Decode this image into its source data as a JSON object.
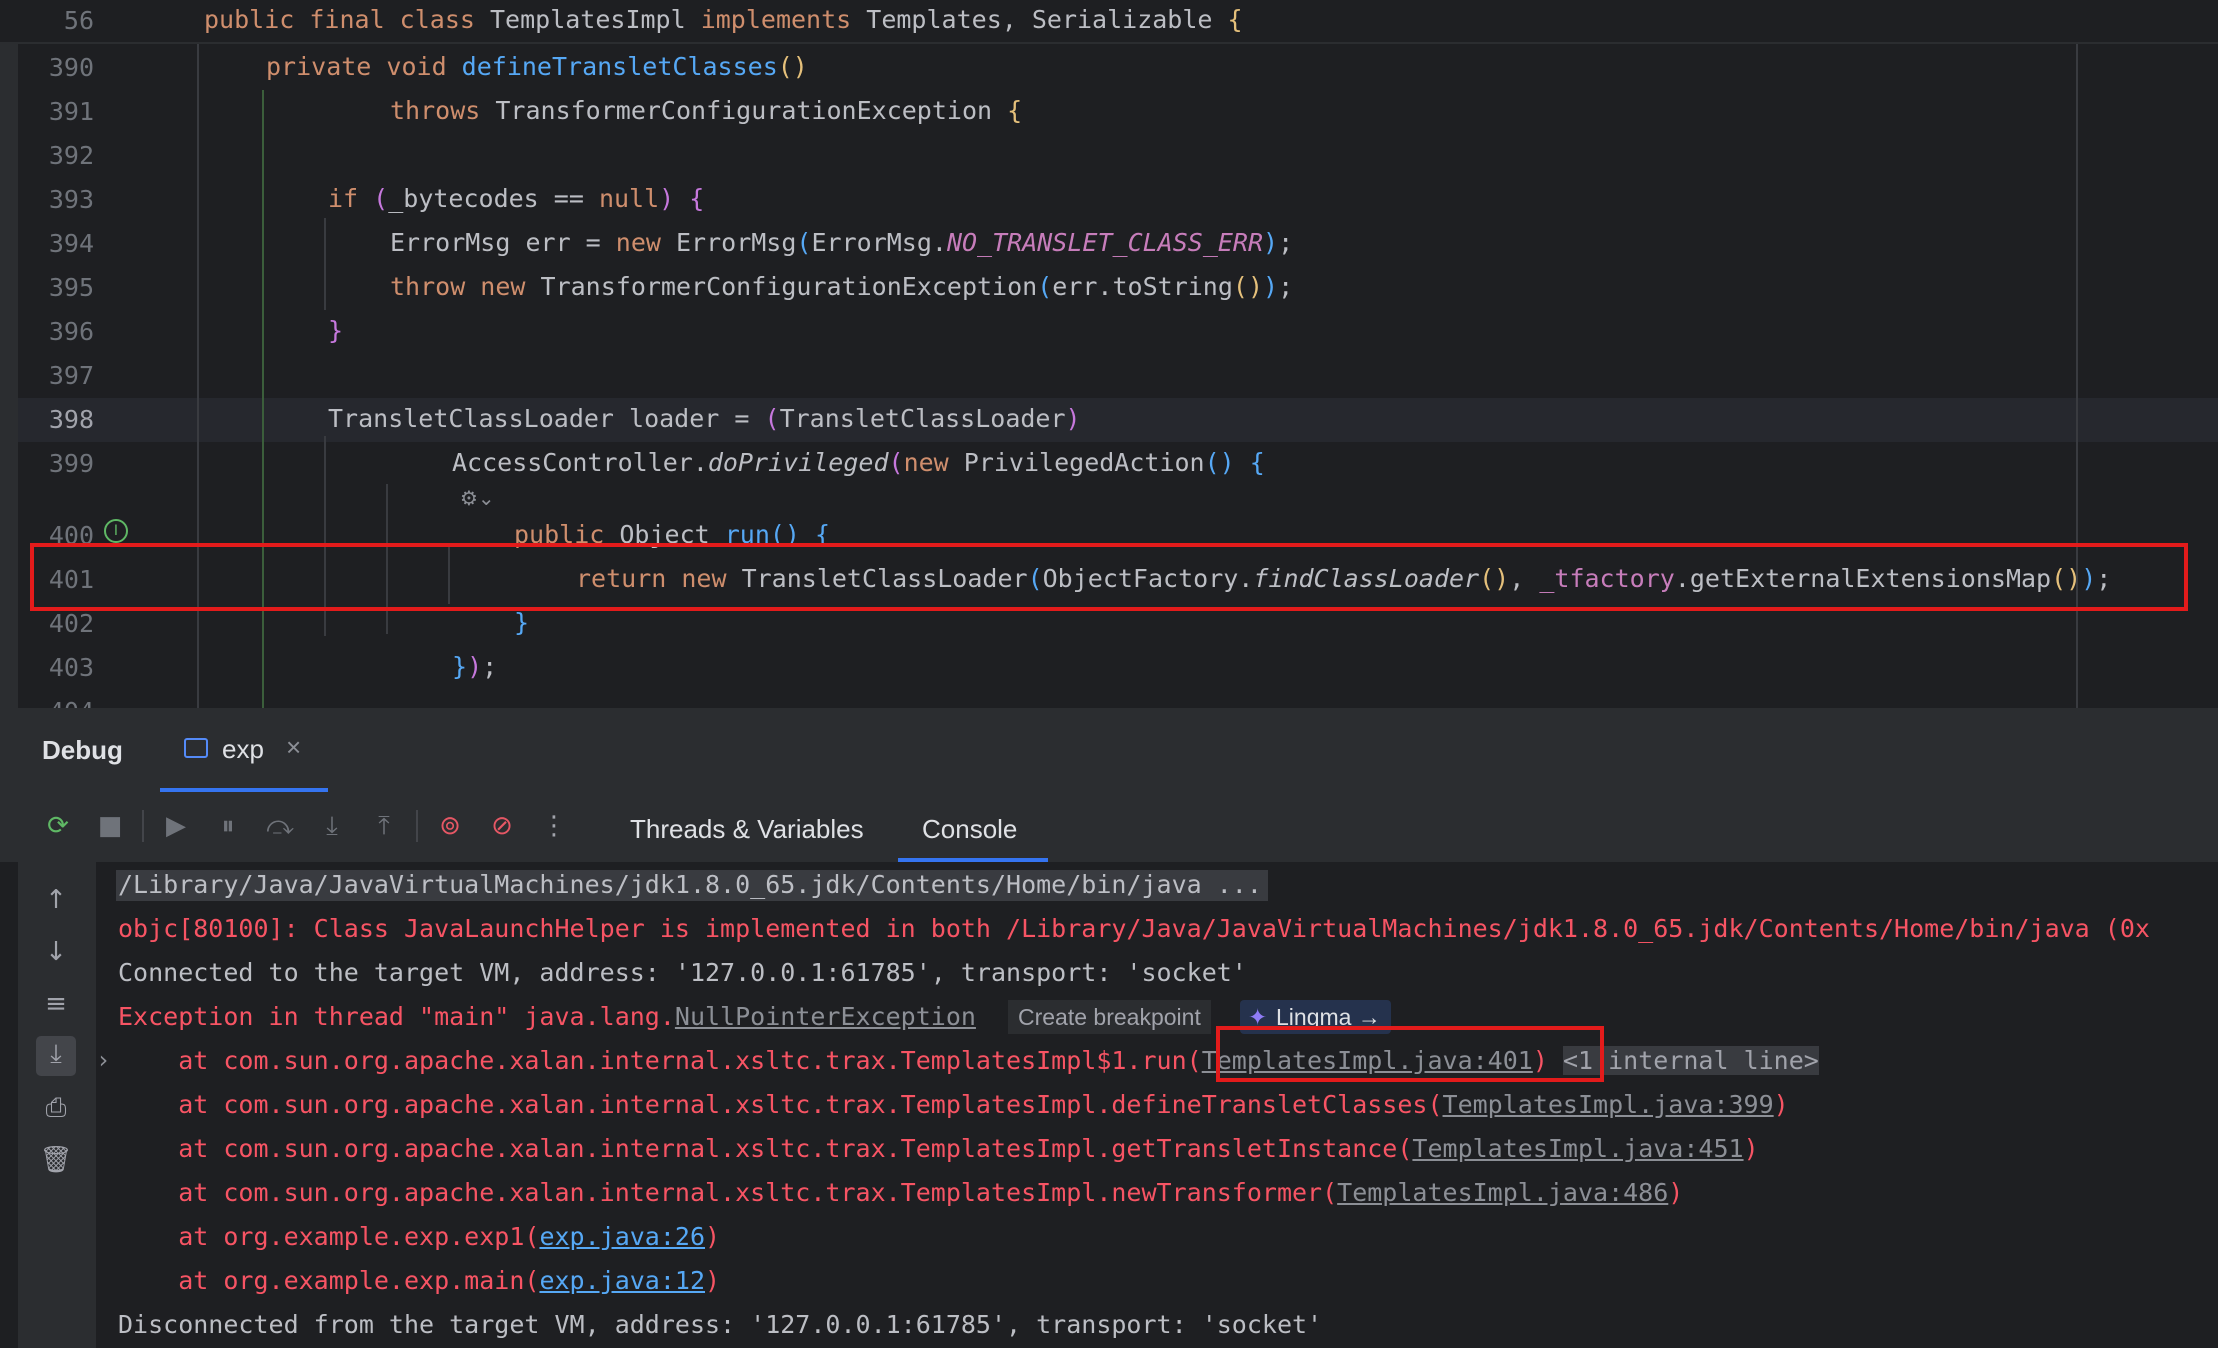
{
  "editor": {
    "sticky": {
      "line": "56",
      "code": "public final class TemplatesImpl implements Templates, Serializable {"
    },
    "lines": [
      {
        "n": "390",
        "c": "private void defineTransletClasses()"
      },
      {
        "n": "391",
        "c": "throws TransformerConfigurationException {"
      },
      {
        "n": "392",
        "c": ""
      },
      {
        "n": "393",
        "c": "if (_bytecodes == null) {"
      },
      {
        "n": "394",
        "c": "ErrorMsg err = new ErrorMsg(ErrorMsg.NO_TRANSLET_CLASS_ERR);"
      },
      {
        "n": "395",
        "c": "throw new TransformerConfigurationException(err.toString());"
      },
      {
        "n": "396",
        "c": "}"
      },
      {
        "n": "397",
        "c": ""
      },
      {
        "n": "398",
        "c": "TransletClassLoader loader = (TransletClassLoader)"
      },
      {
        "n": "399",
        "c": "AccessController.doPrivileged(new PrivilegedAction() {"
      },
      {
        "n": "400",
        "c": "public Object run() {"
      },
      {
        "n": "401",
        "c": "return new TransletClassLoader(ObjectFactory.findClassLoader(), _tfactory.getExternalExtensionsMap());"
      },
      {
        "n": "402",
        "c": "}"
      },
      {
        "n": "403",
        "c": "});"
      },
      {
        "n": "404",
        "c": ""
      }
    ]
  },
  "debug": {
    "title": "Debug",
    "session_tab": "exp",
    "tabs": [
      "Threads & Variables",
      "Console"
    ],
    "active_tab": "Console"
  },
  "console": {
    "l1": "/Library/Java/JavaVirtualMachines/jdk1.8.0_65.jdk/Contents/Home/bin/java ...",
    "l2": "objc[80100]: Class JavaLaunchHelper is implemented in both /Library/Java/JavaVirtualMachines/jdk1.8.0_65.jdk/Contents/Home/bin/java (0x",
    "l3": "Connected to the target VM, address: '127.0.0.1:61785', transport: 'socket'",
    "l4_prefix": "Exception in thread \"main\" java.lang.",
    "l4_link": "NullPointerException",
    "create_breakpoint": "Create breakpoint",
    "lingma": "Lingma →",
    "frames": [
      {
        "pre": "    at com.sun.org.apache.xalan.internal.xsltc.trax.TemplatesImpl$1.run(",
        "link": "TemplatesImpl.java:401",
        "post": ")",
        "extra": "<1 internal line>"
      },
      {
        "pre": "    at com.sun.org.apache.xalan.internal.xsltc.trax.TemplatesImpl.defineTransletClasses(",
        "link": "TemplatesImpl.java:399",
        "post": ")",
        "extra": ""
      },
      {
        "pre": "    at com.sun.org.apache.xalan.internal.xsltc.trax.TemplatesImpl.getTransletInstance(",
        "link": "TemplatesImpl.java:451",
        "post": ")",
        "extra": ""
      },
      {
        "pre": "    at com.sun.org.apache.xalan.internal.xsltc.trax.TemplatesImpl.newTransformer(",
        "link": "TemplatesImpl.java:486",
        "post": ")",
        "extra": ""
      },
      {
        "pre": "    at org.example.exp.exp1(",
        "link": "exp.java:26",
        "post": ")",
        "extra": ""
      },
      {
        "pre": "    at org.example.exp.main(",
        "link": "exp.java:12",
        "post": ")",
        "extra": ""
      }
    ],
    "l_last": "Disconnected from the target VM, address: '127.0.0.1:61785', transport: 'socket'"
  }
}
